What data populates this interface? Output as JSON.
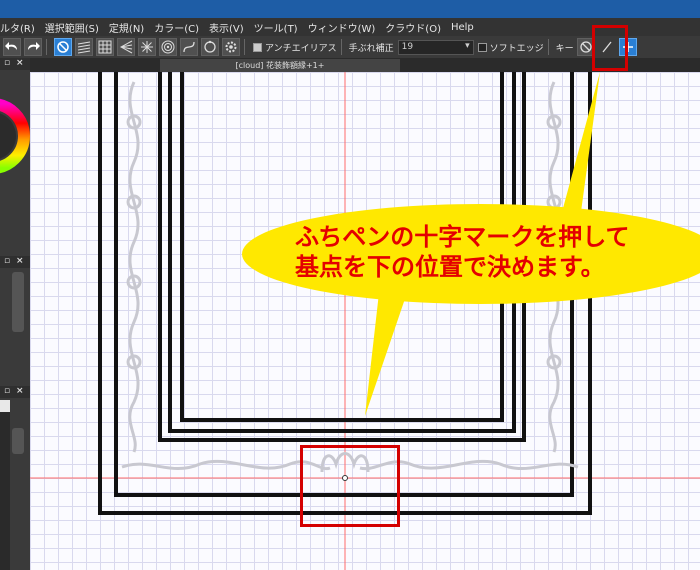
{
  "menu": {
    "items": [
      "ルタ(R)",
      "選択範囲(S)",
      "定規(N)",
      "カラー(C)",
      "表示(V)",
      "ツール(T)",
      "ウィンドウ(W)",
      "クラウド(O)",
      "Help"
    ]
  },
  "toolbar": {
    "antialias_label": "アンチエイリアス",
    "stabilizer_label": "手ぶれ補正",
    "stabilizer_value": "19",
    "softedge_label": "ソフトエッジ",
    "key_label": "キー"
  },
  "document": {
    "tab_title": "[cloud] 花装飾額縁+1+"
  },
  "annotation": {
    "line1": "ふちペンの十字マークを押して",
    "line2": "基点を下の位置で決めます。",
    "bubble_color": "#ffe800",
    "text_color": "#e40000",
    "highlight_color": "#d40000"
  },
  "colors": {
    "title_bar": "#1e5da6",
    "active_tool": "#2a7fd4"
  }
}
